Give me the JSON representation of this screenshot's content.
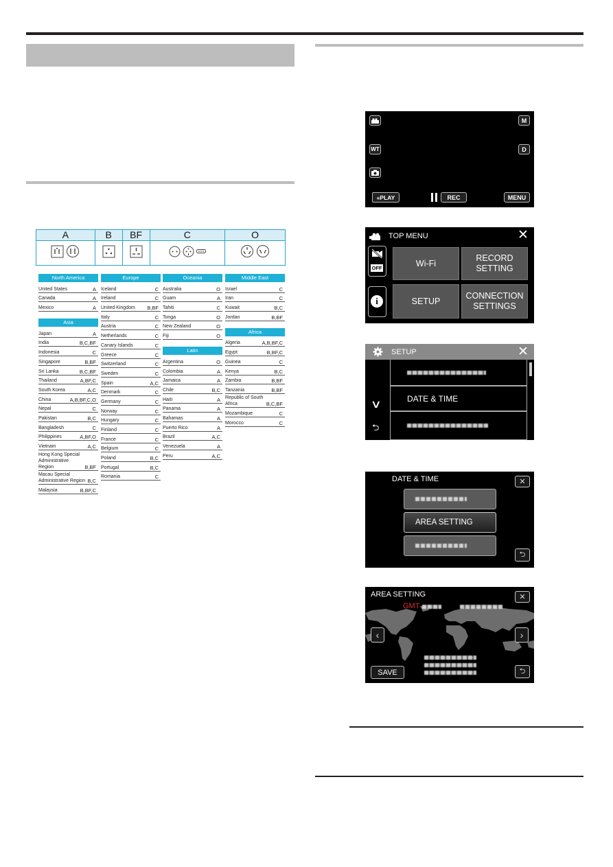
{
  "plug_table": {
    "types": [
      "A",
      "B",
      "BF",
      "C",
      "O"
    ],
    "regions": [
      {
        "name": "North America",
        "countries": [
          {
            "name": "United States",
            "type": "A"
          },
          {
            "name": "Canada",
            "type": "A"
          },
          {
            "name": "Mexico",
            "type": "A"
          }
        ]
      },
      {
        "name": "Asia",
        "countries": [
          {
            "name": "Japan",
            "type": "A"
          },
          {
            "name": "India",
            "type": "B,C,BF"
          },
          {
            "name": "Indonesia",
            "type": "C"
          },
          {
            "name": "Singapore",
            "type": "B,BF"
          },
          {
            "name": "Sri Lanka",
            "type": "B,C,BF"
          },
          {
            "name": "Thailand",
            "type": "A,BF,C"
          },
          {
            "name": "South Korea",
            "type": "A,C"
          },
          {
            "name": "China",
            "type": "A,B,BF,C,O"
          },
          {
            "name": "Nepal",
            "type": "C"
          },
          {
            "name": "Pakistan",
            "type": "B,C"
          },
          {
            "name": "Bangladesh",
            "type": "C"
          },
          {
            "name": "Philippines",
            "type": "A,BF,O"
          },
          {
            "name": "Vietnam",
            "type": "A,C"
          },
          {
            "name": "Hong Kong Special\nAdministrative Region",
            "type": "B,BF"
          },
          {
            "name": "Macau Special\nAdministrative Region",
            "type": "B,C"
          },
          {
            "name": "Malaysia",
            "type": "B,BF,C"
          }
        ]
      },
      {
        "name": "Europe",
        "countries": [
          {
            "name": "Iceland",
            "type": "C"
          },
          {
            "name": "Ireland",
            "type": "C"
          },
          {
            "name": "United Kingdom",
            "type": "B,BF"
          },
          {
            "name": "Italy",
            "type": "C"
          },
          {
            "name": "Austria",
            "type": "C"
          },
          {
            "name": "Netherlands",
            "type": "C"
          },
          {
            "name": "Canary Islands",
            "type": "C"
          },
          {
            "name": "Greece",
            "type": "C"
          },
          {
            "name": "Switzerland",
            "type": "C"
          },
          {
            "name": "Sweden",
            "type": "C"
          },
          {
            "name": "Spain",
            "type": "A,C"
          },
          {
            "name": "Denmark",
            "type": "C"
          },
          {
            "name": "Germany",
            "type": "C"
          },
          {
            "name": "Norway",
            "type": "C"
          },
          {
            "name": "Hungary",
            "type": "C"
          },
          {
            "name": "Finland",
            "type": "C"
          },
          {
            "name": "France",
            "type": "C"
          },
          {
            "name": "Belgium",
            "type": "C"
          },
          {
            "name": "Poland",
            "type": "B,C"
          },
          {
            "name": "Portugal",
            "type": "B,C"
          },
          {
            "name": "Romania",
            "type": "C"
          }
        ]
      },
      {
        "name": "Oceania",
        "countries": [
          {
            "name": "Australia",
            "type": "O"
          },
          {
            "name": "Guam",
            "type": "A"
          },
          {
            "name": "Tahiti",
            "type": "C"
          },
          {
            "name": "Tonga",
            "type": "O"
          },
          {
            "name": "New Zealand",
            "type": "O"
          },
          {
            "name": "Fiji",
            "type": "O"
          }
        ]
      },
      {
        "name": "Latin",
        "countries": [
          {
            "name": "Argentina",
            "type": "O"
          },
          {
            "name": "Colombia",
            "type": "A"
          },
          {
            "name": "Jamaica",
            "type": "A"
          },
          {
            "name": "Chile",
            "type": "B,C"
          },
          {
            "name": "Haiti",
            "type": "A"
          },
          {
            "name": "Panama",
            "type": "A"
          },
          {
            "name": "Bahamas",
            "type": "A"
          },
          {
            "name": "Puerto Rico",
            "type": "A"
          },
          {
            "name": "Brazil",
            "type": "A,C"
          },
          {
            "name": "Venezuela",
            "type": "A"
          },
          {
            "name": "Peru",
            "type": "A,C"
          }
        ]
      },
      {
        "name": "Middle East",
        "countries": [
          {
            "name": "Israel",
            "type": "C"
          },
          {
            "name": "Iran",
            "type": "C"
          },
          {
            "name": "Kuwait",
            "type": "B,C"
          },
          {
            "name": "Jordan",
            "type": "B,BF"
          }
        ]
      },
      {
        "name": "Africa",
        "countries": [
          {
            "name": "Algeria",
            "type": "A,B,BF,C"
          },
          {
            "name": "Egypt",
            "type": "B,BF,C"
          },
          {
            "name": "Guinea",
            "type": "C"
          },
          {
            "name": "Kenya",
            "type": "B,C"
          },
          {
            "name": "Zambia",
            "type": "B,BF"
          },
          {
            "name": "Tanzania",
            "type": "B,BF"
          },
          {
            "name": "Republic of South\nAfrica",
            "type": "B,C,BF"
          },
          {
            "name": "Mozambique",
            "type": "C"
          },
          {
            "name": "Morocco",
            "type": "C"
          }
        ]
      }
    ]
  },
  "screens": {
    "record": {
      "left_icons": [
        "video-mode-icon",
        "WT",
        "photo-mode-icon"
      ],
      "right_buttons": [
        "M",
        "D"
      ],
      "play_label": "«PLAY",
      "rec_label": "REC",
      "menu_label": "MENU"
    },
    "top_menu": {
      "title": "TOP MENU",
      "off_label": "OFF",
      "tiles": [
        "Wi-Fi",
        "RECORD\nSETTING",
        "SETUP",
        "CONNECTION\nSETTINGS"
      ]
    },
    "setup": {
      "title": "SETUP",
      "selected_item": "DATE & TIME"
    },
    "date_time": {
      "title": "DATE & TIME",
      "selected_item": "AREA SETTING"
    },
    "area_setting": {
      "title": "AREA SETTING",
      "gmt_label": "GMT",
      "save_label": "SAVE",
      "gmt_color": "#e0302a"
    }
  },
  "colors": {
    "table_accent": "#1fb0d6",
    "section_gray": "#bdbdbd"
  }
}
